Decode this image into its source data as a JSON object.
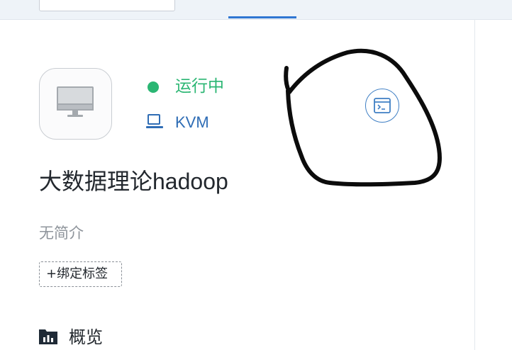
{
  "vm": {
    "status": "运行中",
    "hypervisor": "KVM",
    "name": "大数据理论hadoop",
    "description": "无简介",
    "bind_tag_label": "+绑定标签"
  },
  "section": {
    "overview_label": "概览"
  },
  "icons": {
    "vm_card": "monitor-icon",
    "hypervisor": "laptop-icon",
    "console": "terminal-icon",
    "overview": "bar-chart-folder-icon"
  },
  "colors": {
    "status_running": "#2bb673",
    "accent": "#2f76d2",
    "hypervisor_text": "#2f6db5"
  }
}
